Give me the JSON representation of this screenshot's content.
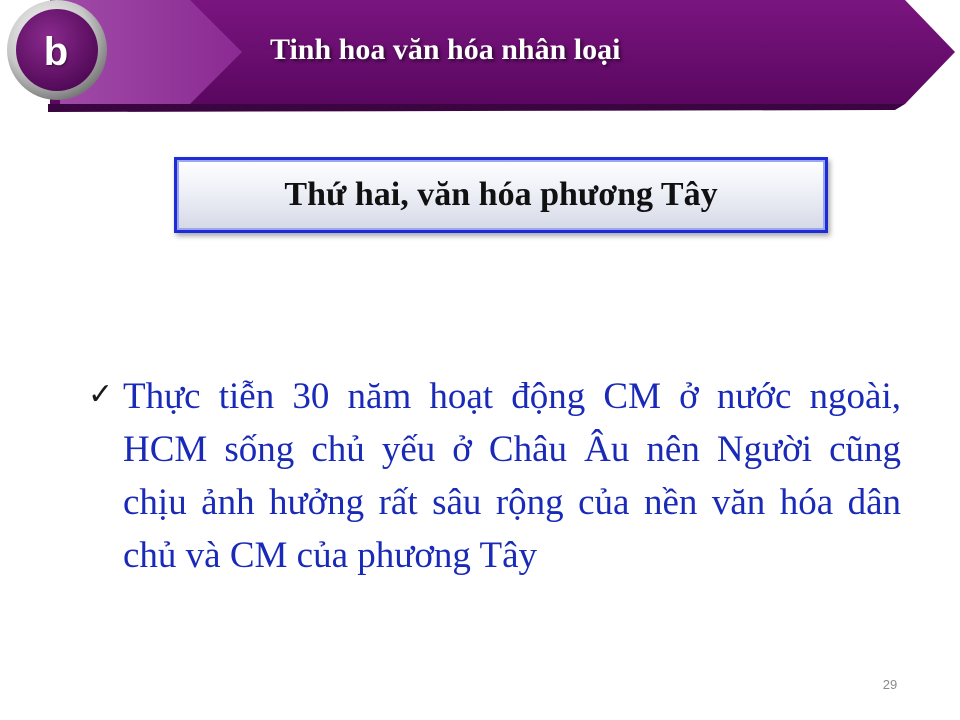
{
  "header": {
    "badge_letter": "b",
    "title": "Tinh hoa văn hóa nhân loại"
  },
  "subtitle": "Thứ hai, văn hóa phương Tây",
  "bullet_icon": "checkmark-icon",
  "body": "Thực tiễn 30 năm hoạt động CM ở nước ngoài, HCM sống chủ yếu ở Châu Âu nên Người cũng chịu ảnh hưởng rất sâu rộng của nền văn hóa dân chủ và CM của phương Tây",
  "page_number": "29",
  "colors": {
    "banner": "#6a0a6e",
    "banner_dark": "#4a0750",
    "body_text": "#1a2ab8",
    "subtitle_border": "#1f2bd6"
  }
}
